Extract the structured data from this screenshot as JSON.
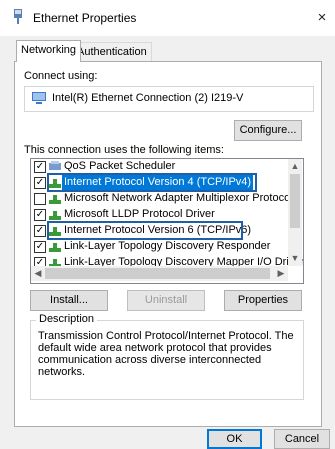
{
  "window": {
    "title": "Ethernet Properties",
    "close_glyph": "×"
  },
  "tabs": [
    {
      "label": "Networking",
      "active": true
    },
    {
      "label": "Authentication",
      "active": false
    }
  ],
  "connect_using": {
    "label": "Connect using:",
    "adapter": "Intel(R) Ethernet Connection (2) I219-V",
    "configure_label": "Configure..."
  },
  "items_label": "This connection uses the following items:",
  "items": [
    {
      "label": "QoS Packet Scheduler",
      "checked": true,
      "icon": "qos-icon"
    },
    {
      "label": "Internet Protocol Version 4 (TCP/IPv4)",
      "checked": true,
      "icon": "protocol-icon",
      "selected": true
    },
    {
      "label": "Microsoft Network Adapter Multiplexor Protocol",
      "checked": false,
      "icon": "protocol-icon"
    },
    {
      "label": "Microsoft LLDP Protocol Driver",
      "checked": true,
      "icon": "protocol-icon"
    },
    {
      "label": "Internet Protocol Version 6 (TCP/IPv6)",
      "checked": true,
      "icon": "protocol-icon",
      "highlighted": true
    },
    {
      "label": "Link-Layer Topology Discovery Responder",
      "checked": true,
      "icon": "protocol-icon"
    },
    {
      "label": "Link-Layer Topology Discovery Mapper I/O Driver",
      "checked": true,
      "icon": "protocol-icon"
    }
  ],
  "item_buttons": {
    "install": "Install...",
    "uninstall": "Uninstall",
    "properties": "Properties"
  },
  "description": {
    "title": "Description",
    "text": "Transmission Control Protocol/Internet Protocol. The default wide area network protocol that provides communication across diverse interconnected networks."
  },
  "footer": {
    "ok": "OK",
    "cancel": "Cancel"
  },
  "colors": {
    "highlight_border": "#1f5fa8",
    "accent": "#0078d7",
    "protocol_icon": "#3a9a3a"
  }
}
